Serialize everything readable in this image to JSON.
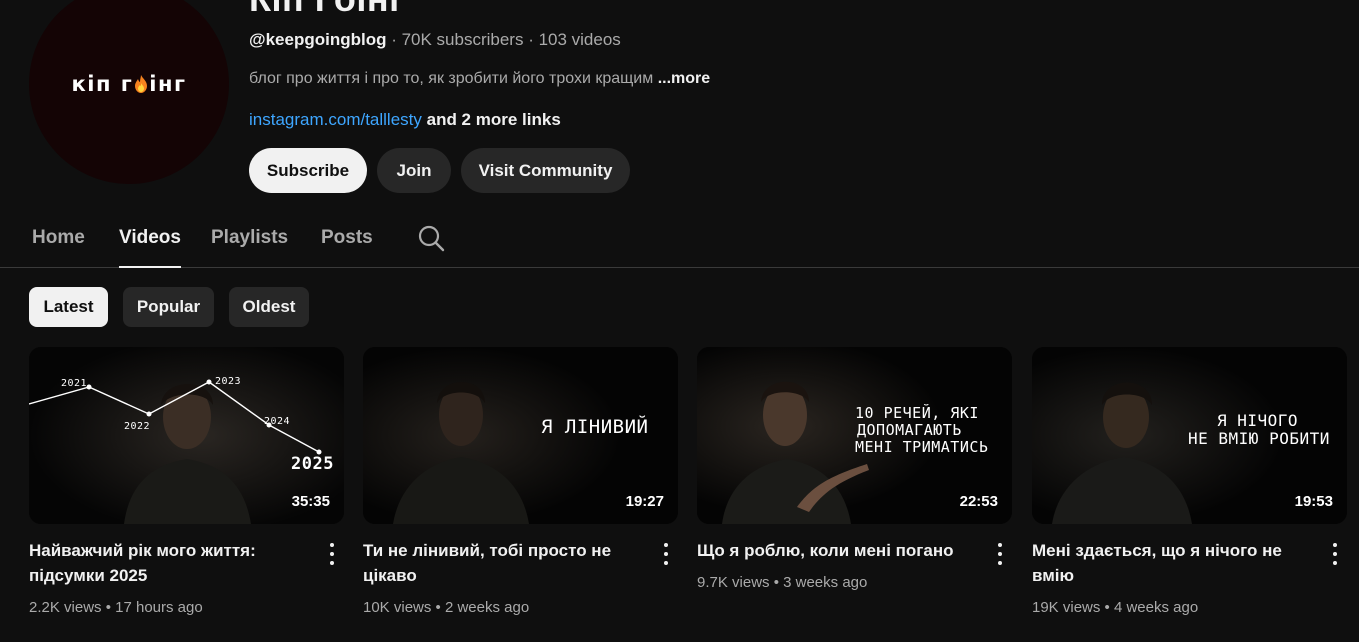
{
  "channel": {
    "title": "Кіп Гоінг",
    "avatar_text": "кіп г",
    "avatar_text_end": "інг",
    "handle": "@keepgoingblog",
    "meta_rest": " · 70K subscribers · 103 videos",
    "description": "блог про життя і про то, як зробити його трохи кращим ",
    "more_label": "...more",
    "link": "instagram.com/talllesty",
    "extra_links": " and 2 more links"
  },
  "buttons": {
    "subscribe": "Subscribe",
    "join": "Join",
    "community": "Visit Community"
  },
  "tabs": [
    {
      "label": "Home"
    },
    {
      "label": "Videos"
    },
    {
      "label": "Playlists"
    },
    {
      "label": "Posts"
    }
  ],
  "chips": [
    {
      "label": "Latest"
    },
    {
      "label": "Popular"
    },
    {
      "label": "Oldest"
    }
  ],
  "videos": [
    {
      "title": "Найважчий рік мого життя: підсумки 2025",
      "stats": "2.2K views • 17 hours ago",
      "duration": "35:35",
      "graph_labels": [
        "2021",
        "2022",
        "2023",
        "2024",
        "2025"
      ]
    },
    {
      "title": "Ти не лінивий, тобі просто не цікаво",
      "stats": "10K views • 2 weeks ago",
      "duration": "19:27",
      "thumb_text": "Я ЛІНИВИЙ"
    },
    {
      "title": "Що я роблю, коли мені погано",
      "stats": "9.7K views • 3 weeks ago",
      "duration": "22:53",
      "thumb_lines": [
        "10 РЕЧЕЙ, ЯКІ",
        "ДОПОМАГАЮТЬ",
        "МЕНІ ТРИМАТИСЬ"
      ]
    },
    {
      "title": "Мені здається, що я нічого не вмію",
      "stats": "19K views • 4 weeks ago",
      "duration": "19:53",
      "thumb_lines": [
        "Я НІЧОГО",
        "НЕ ВМІЮ РОБИТИ"
      ]
    }
  ],
  "colors": {
    "background": "#0f0f0f",
    "link": "#3ea6ff",
    "chip": "#272727"
  }
}
